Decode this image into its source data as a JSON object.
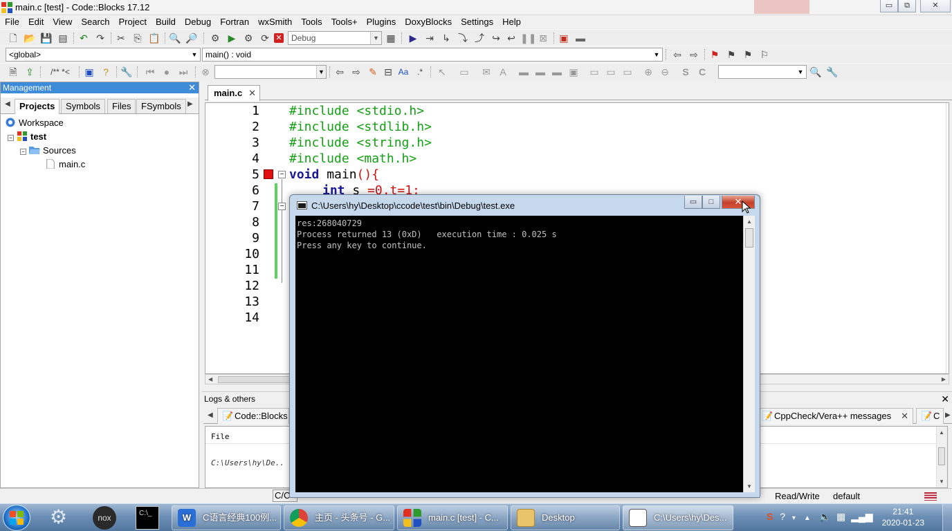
{
  "window": {
    "title": "main.c [test] - Code::Blocks 17.12",
    "controls": [
      "▭",
      "⧉",
      "✕"
    ]
  },
  "menu": [
    "File",
    "Edit",
    "View",
    "Search",
    "Project",
    "Build",
    "Debug",
    "Fortran",
    "wxSmith",
    "Tools",
    "Tools+",
    "Plugins",
    "DoxyBlocks",
    "Settings",
    "Help"
  ],
  "toolbar": {
    "build_target": "Debug",
    "scope": "<global>",
    "function": "main() : void",
    "doc_comment": "/** *<"
  },
  "management": {
    "title": "Management",
    "tabs": [
      "Projects",
      "Symbols",
      "Files",
      "FSymbols"
    ],
    "active_tab": "Projects",
    "tree": {
      "workspace": "Workspace",
      "project": "test",
      "folder": "Sources",
      "file": "main.c"
    }
  },
  "editor": {
    "tab": "main.c",
    "line_numbers": [
      "1",
      "2",
      "3",
      "4",
      "5",
      "6",
      "7",
      "8",
      "9",
      "10",
      "11",
      "12",
      "13",
      "14"
    ],
    "lines": {
      "l1": "#include <stdio.h>",
      "l2": "#include <stdlib.h>",
      "l3": "#include <string.h>",
      "l4": "#include <math.h>",
      "l5_kw": "void",
      "l5_rest": " main",
      "l5_paren": "(){",
      "l6_kw": "int",
      "l6_rest": " s ",
      "l6_red": "=0,t=1;"
    }
  },
  "logs": {
    "title": "Logs & others",
    "tabs": [
      "Code::Blocks",
      "CppCheck/Vera++ messages",
      "C"
    ],
    "column_file": "File",
    "row_path": "C:\\Users\\hy\\De.."
  },
  "statusbar": {
    "lang": "C/C+",
    "mode": "Read/Write",
    "profile": "default"
  },
  "console": {
    "title": "C:\\Users\\hy\\Desktop\\ccode\\test\\bin\\Debug\\test.exe",
    "output": [
      "res:268040729",
      "Process returned 13 (0xD)   execution time : 0.025 s",
      "Press any key to continue."
    ]
  },
  "taskbar": {
    "buttons": [
      {
        "label": "C语言经典100例..."
      },
      {
        "label": "主页 - 头条号 - G..."
      },
      {
        "label": "main.c [test] - C..."
      },
      {
        "label": "Desktop"
      },
      {
        "label": "C:\\Users\\hy\\Des..."
      }
    ],
    "time": "21:41",
    "date": "2020-01-23"
  },
  "colors": {
    "accent": "#3e8cd8",
    "preprocessor": "#14a014",
    "keyword": "#1a1a99",
    "breakpoint": "#e01010"
  }
}
